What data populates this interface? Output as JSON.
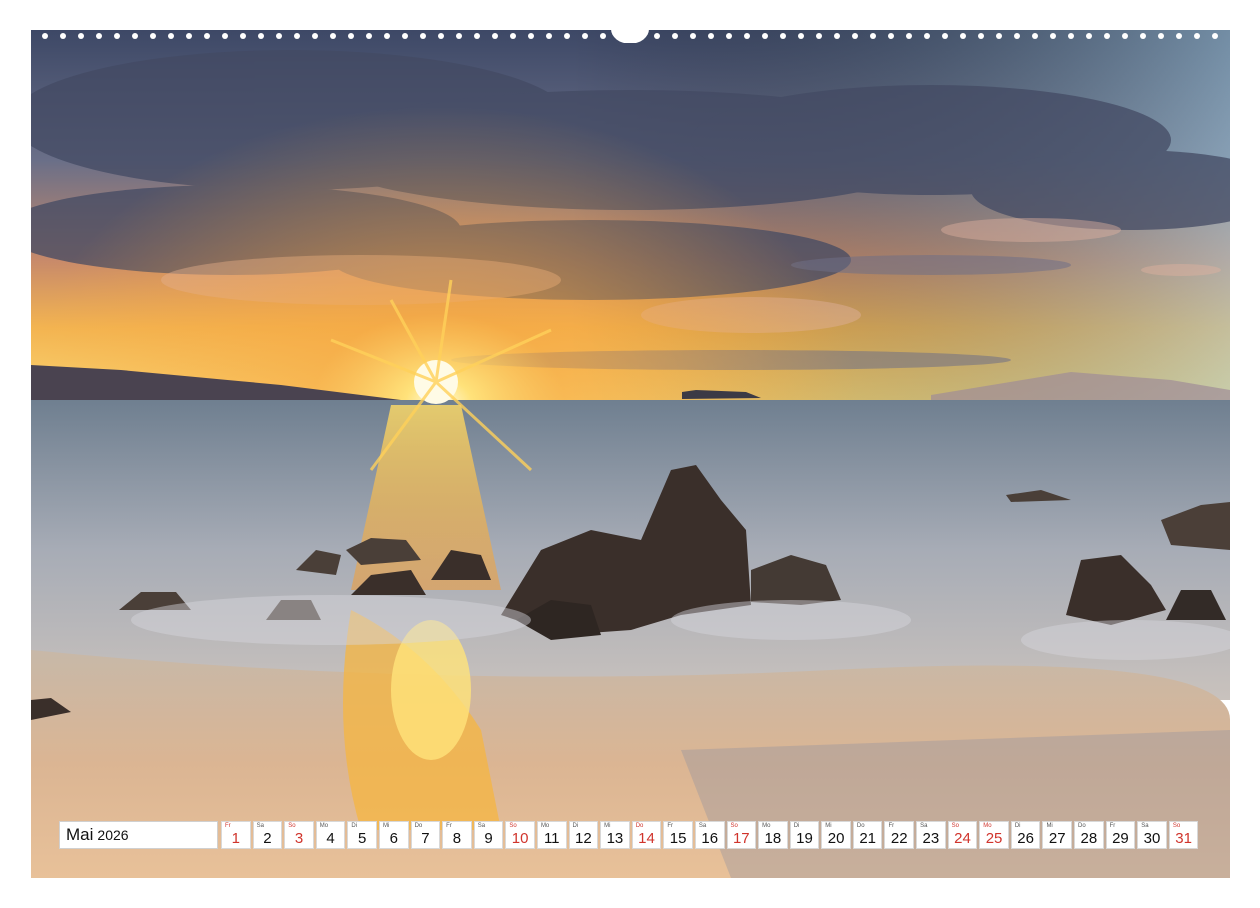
{
  "calendar": {
    "month": "Mai",
    "year": "2026",
    "days": [
      {
        "wd": "Fr",
        "num": "1",
        "sun": true
      },
      {
        "wd": "Sa",
        "num": "2",
        "sun": false
      },
      {
        "wd": "So",
        "num": "3",
        "sun": true
      },
      {
        "wd": "Mo",
        "num": "4",
        "sun": false
      },
      {
        "wd": "Di",
        "num": "5",
        "sun": false
      },
      {
        "wd": "Mi",
        "num": "6",
        "sun": false
      },
      {
        "wd": "Do",
        "num": "7",
        "sun": false
      },
      {
        "wd": "Fr",
        "num": "8",
        "sun": false
      },
      {
        "wd": "Sa",
        "num": "9",
        "sun": false
      },
      {
        "wd": "So",
        "num": "10",
        "sun": true
      },
      {
        "wd": "Mo",
        "num": "11",
        "sun": false
      },
      {
        "wd": "Di",
        "num": "12",
        "sun": false
      },
      {
        "wd": "Mi",
        "num": "13",
        "sun": false
      },
      {
        "wd": "Do",
        "num": "14",
        "sun": true
      },
      {
        "wd": "Fr",
        "num": "15",
        "sun": false
      },
      {
        "wd": "Sa",
        "num": "16",
        "sun": false
      },
      {
        "wd": "So",
        "num": "17",
        "sun": true
      },
      {
        "wd": "Mo",
        "num": "18",
        "sun": false
      },
      {
        "wd": "Di",
        "num": "19",
        "sun": false
      },
      {
        "wd": "Mi",
        "num": "20",
        "sun": false
      },
      {
        "wd": "Do",
        "num": "21",
        "sun": false
      },
      {
        "wd": "Fr",
        "num": "22",
        "sun": false
      },
      {
        "wd": "Sa",
        "num": "23",
        "sun": false
      },
      {
        "wd": "So",
        "num": "24",
        "sun": true
      },
      {
        "wd": "Mo",
        "num": "25",
        "sun": true
      },
      {
        "wd": "Di",
        "num": "26",
        "sun": false
      },
      {
        "wd": "Mi",
        "num": "27",
        "sun": false
      },
      {
        "wd": "Do",
        "num": "28",
        "sun": false
      },
      {
        "wd": "Fr",
        "num": "29",
        "sun": false
      },
      {
        "wd": "Sa",
        "num": "30",
        "sun": false
      },
      {
        "wd": "So",
        "num": "31",
        "sun": true
      }
    ]
  },
  "colors": {
    "holiday_red": "#d0342c",
    "sky_top": "#3f4a66",
    "sun": "#fff2a8",
    "sea": "#8f99a8",
    "sand": "#e0b890"
  }
}
